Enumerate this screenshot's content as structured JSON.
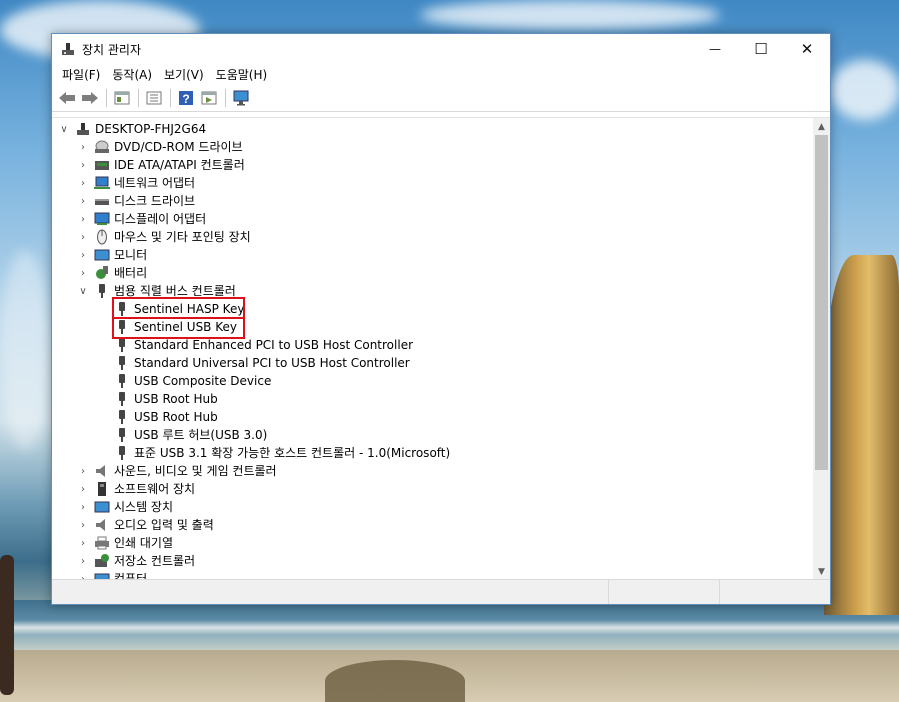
{
  "window": {
    "title": "장치 관리자",
    "controls": {
      "minimize": "—",
      "maximize": "☐",
      "close": "✕"
    }
  },
  "menu": [
    "파일(F)",
    "동작(A)",
    "보기(V)",
    "도움말(H)"
  ],
  "toolbar": [
    "back-arrow-icon",
    "forward-arrow-icon",
    "properties-icon",
    "device-list-icon",
    "help-icon",
    "run-icon",
    "monitor-icon"
  ],
  "tree": {
    "root": "DESKTOP-FHJ2G64",
    "items": [
      {
        "label": "DVD/CD-ROM 드라이브",
        "icon": "dvd-drive-icon",
        "expanded": false
      },
      {
        "label": "IDE ATA/ATAPI 컨트롤러",
        "icon": "ide-controller-icon",
        "expanded": false
      },
      {
        "label": "네트워크 어댑터",
        "icon": "network-adapter-icon",
        "expanded": false
      },
      {
        "label": "디스크 드라이브",
        "icon": "disk-drive-icon",
        "expanded": false
      },
      {
        "label": "디스플레이 어댑터",
        "icon": "display-adapter-icon",
        "expanded": false
      },
      {
        "label": "마우스 및 기타 포인팅 장치",
        "icon": "mouse-icon",
        "expanded": false
      },
      {
        "label": "모니터",
        "icon": "monitor-icon",
        "expanded": false
      },
      {
        "label": "배터리",
        "icon": "battery-icon",
        "expanded": false
      },
      {
        "label": "범용 직렬 버스 컨트롤러",
        "icon": "usb-icon",
        "expanded": true,
        "children": [
          "Sentinel HASP Key",
          "Sentinel USB Key",
          "Standard Enhanced PCI to USB Host Controller",
          "Standard Universal PCI to USB Host Controller",
          "USB Composite Device",
          "USB Root Hub",
          "USB Root Hub",
          "USB 루트 허브(USB 3.0)",
          "표준 USB 3.1 확장 가능한 호스트 컨트롤러 - 1.0(Microsoft)"
        ]
      },
      {
        "label": "사운드, 비디오 및 게임 컨트롤러",
        "icon": "speaker-icon",
        "expanded": false
      },
      {
        "label": "소프트웨어 장치",
        "icon": "software-device-icon",
        "expanded": false
      },
      {
        "label": "시스템 장치",
        "icon": "system-device-icon",
        "expanded": false
      },
      {
        "label": "오디오 입력 및 출력",
        "icon": "audio-icon",
        "expanded": false
      },
      {
        "label": "인쇄 대기열",
        "icon": "printer-icon",
        "expanded": false
      },
      {
        "label": "저장소 컨트롤러",
        "icon": "storage-controller-icon",
        "expanded": false
      },
      {
        "label": "컴퓨터",
        "icon": "computer-icon",
        "expanded": false
      }
    ]
  },
  "highlight_color": "#e0101a"
}
